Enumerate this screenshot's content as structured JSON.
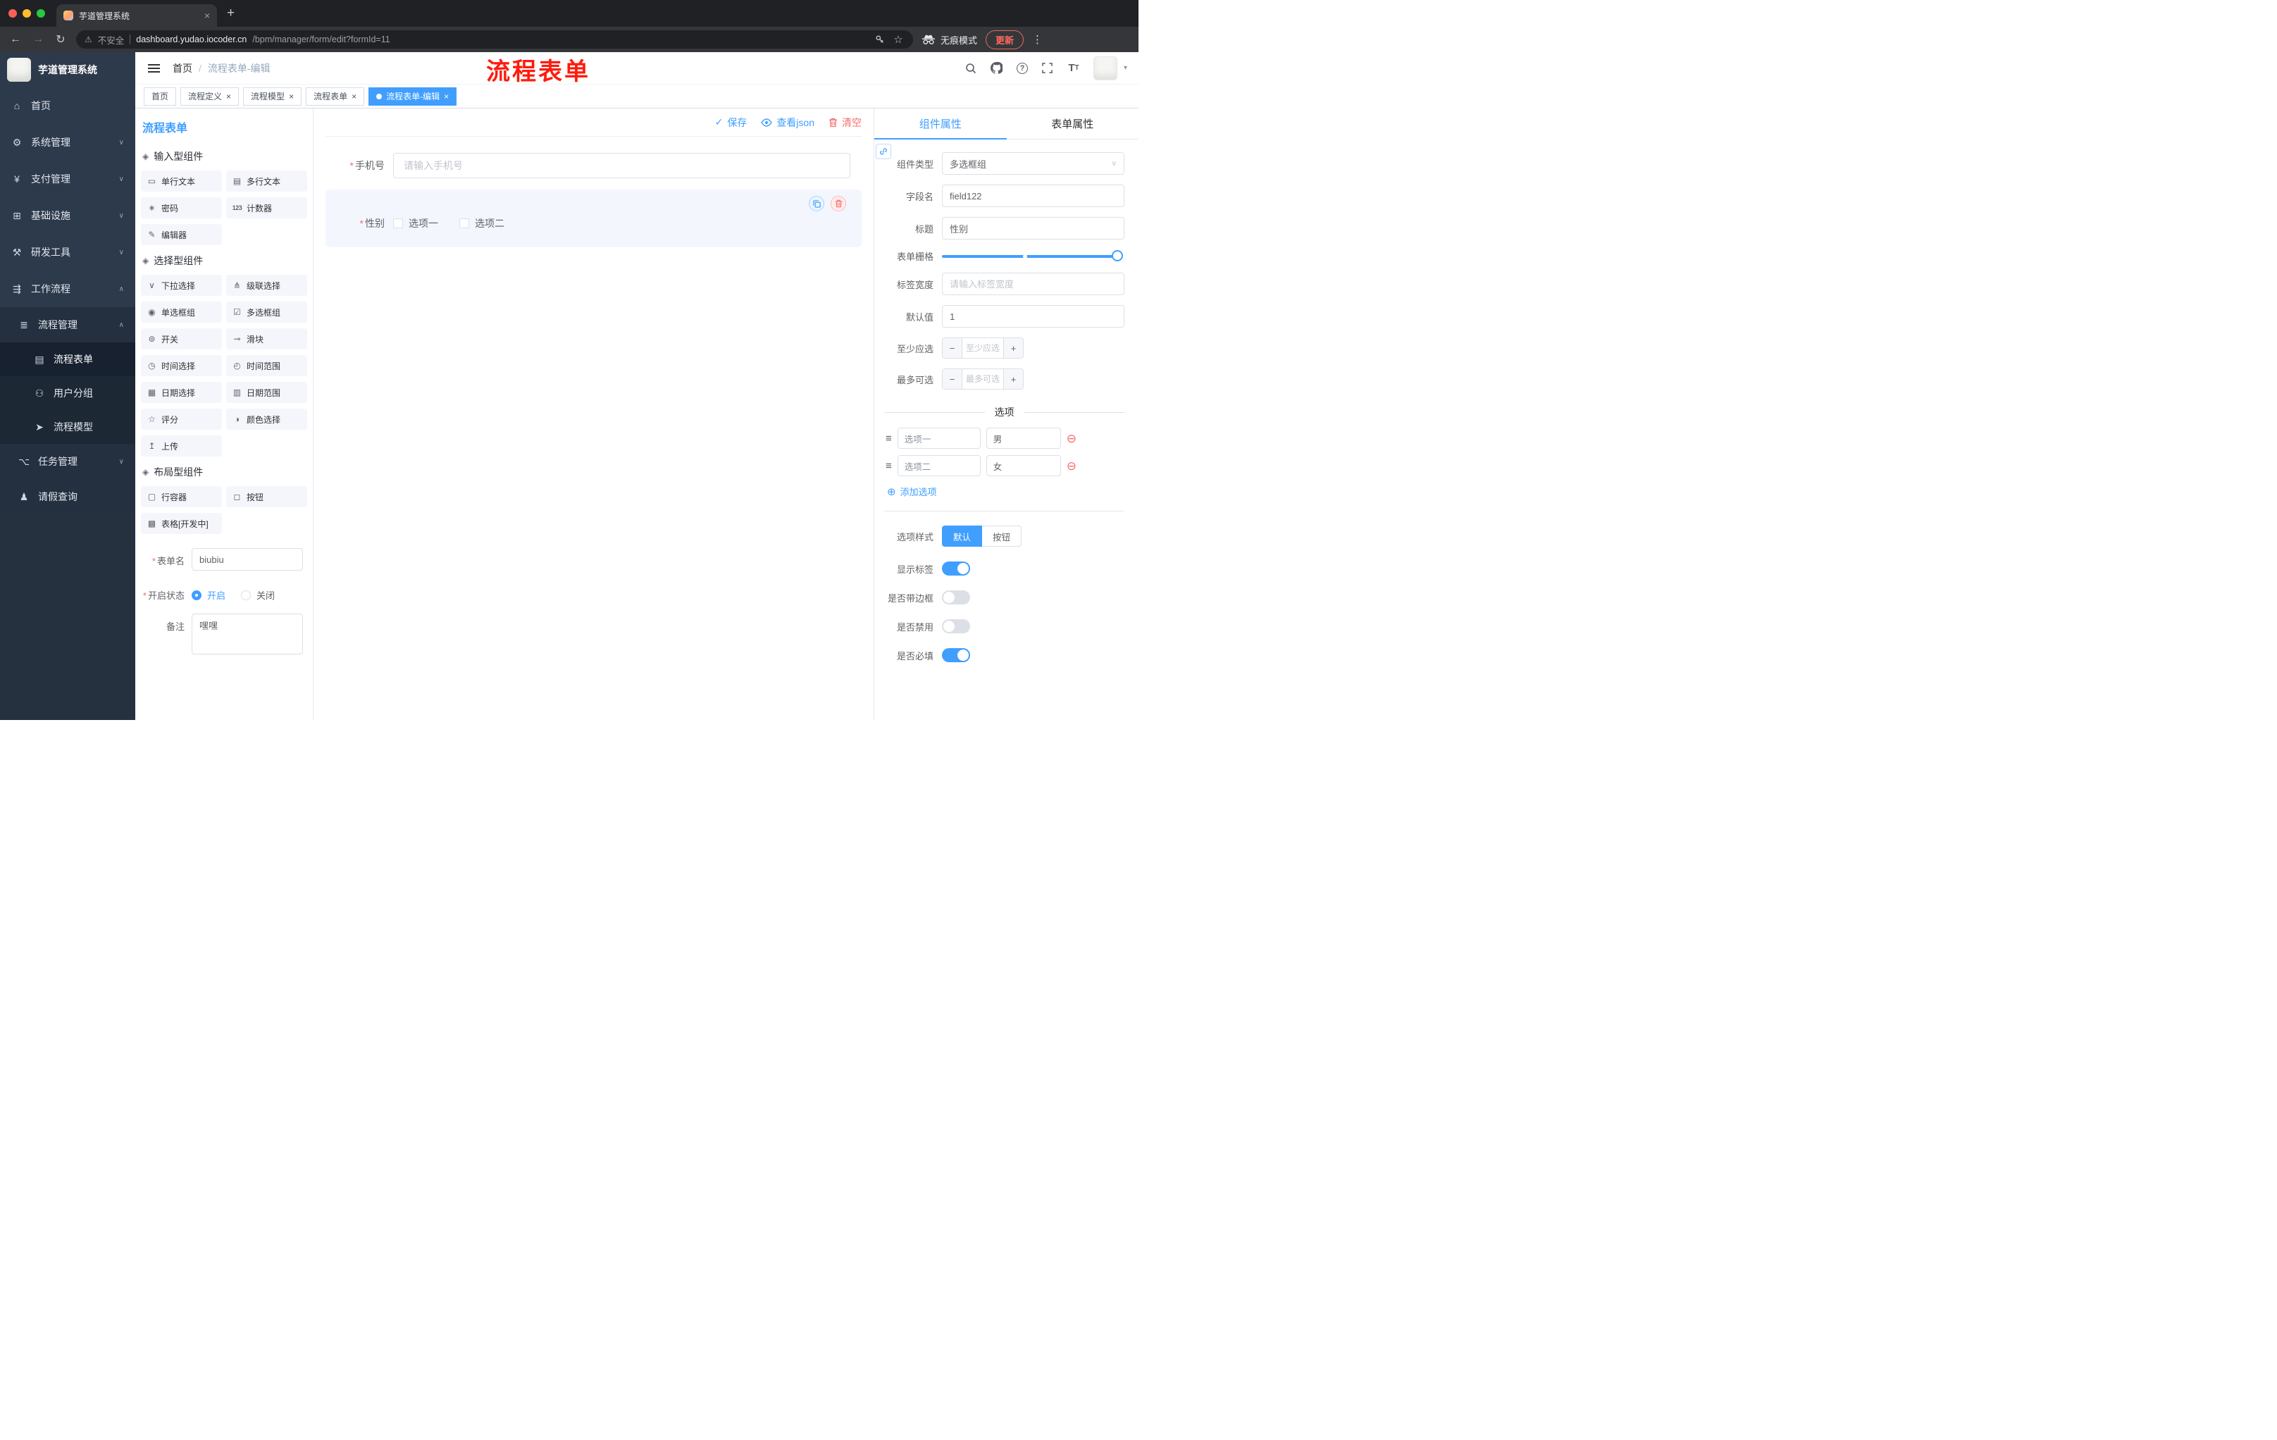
{
  "chrome": {
    "tab": {
      "title": "芋道管理系统",
      "close": "×"
    },
    "newtab": "+",
    "nav": {
      "back": "←",
      "forward": "→",
      "reload": "↻"
    },
    "warning_icon": "⚠",
    "security": "不安全",
    "url_host": "dashboard.yudao.iocoder.cn",
    "url_path": "/bpm/manager/form/edit?formId=11",
    "bookmark_icon": "☆",
    "incognito": "无痕模式",
    "update": "更新",
    "menu_icon": "⋮"
  },
  "sidebar": {
    "title": "芋道管理系统",
    "menu": [
      {
        "icon": "⌂",
        "label": "首页",
        "arrow": ""
      },
      {
        "icon": "⚙",
        "label": "系统管理",
        "arrow": "∨"
      },
      {
        "icon": "¥",
        "label": "支付管理",
        "arrow": "∨"
      },
      {
        "icon": "⊞",
        "label": "基础设施",
        "arrow": "∨"
      },
      {
        "icon": "⚒",
        "label": "研发工具",
        "arrow": "∨"
      },
      {
        "icon": "⇶",
        "label": "工作流程",
        "arrow": "∧"
      }
    ],
    "process_group": {
      "icon": "≣",
      "label": "流程管理",
      "arrow": "∧"
    },
    "process_children": [
      {
        "icon": "▤",
        "label": "流程表单"
      },
      {
        "icon": "⚇",
        "label": "用户分组"
      },
      {
        "icon": "➤",
        "label": "流程模型"
      }
    ],
    "task": {
      "icon": "⌥",
      "label": "任务管理",
      "arrow": "∨"
    },
    "leave": {
      "icon": "♟",
      "label": "请假查询"
    }
  },
  "navbar": {
    "breadcrumb_home": "首页",
    "breadcrumb_sep": "/",
    "breadcrumb_current": "流程表单-编辑",
    "caret": "▾"
  },
  "annotation": "流程表单",
  "close_x": "×",
  "active_dot": "",
  "required_marker": "*",
  "tags": [
    {
      "label": "首页"
    },
    {
      "label": "流程定义"
    },
    {
      "label": "流程模型"
    },
    {
      "label": "流程表单"
    },
    {
      "label": "流程表单-编辑"
    }
  ],
  "palette": {
    "title": "流程表单",
    "group_icon": "◈",
    "groups": [
      {
        "title": "输入型组件",
        "items": [
          {
            "icon": "▭",
            "label": "单行文本"
          },
          {
            "icon": "▤",
            "label": "多行文本"
          },
          {
            "icon": "∗",
            "label": "密码"
          },
          {
            "icon": "123",
            "label": "计数器"
          },
          {
            "icon": "✎",
            "label": "编辑器"
          }
        ]
      },
      {
        "title": "选择型组件",
        "items": [
          {
            "icon": "∨",
            "label": "下拉选择"
          },
          {
            "icon": "⋔",
            "label": "级联选择"
          },
          {
            "icon": "◉",
            "label": "单选框组"
          },
          {
            "icon": "☑",
            "label": "多选框组"
          },
          {
            "icon": "⊚",
            "label": "开关"
          },
          {
            "icon": "⊸",
            "label": "滑块"
          },
          {
            "icon": "◷",
            "label": "时间选择"
          },
          {
            "icon": "◴",
            "label": "时间范围"
          },
          {
            "icon": "▦",
            "label": "日期选择"
          },
          {
            "icon": "▥",
            "label": "日期范围"
          },
          {
            "icon": "☆",
            "label": "评分"
          },
          {
            "icon": "◑",
            "label": "颜色选择"
          },
          {
            "icon": "↥",
            "label": "上传"
          }
        ]
      },
      {
        "title": "布局型组件",
        "items": [
          {
            "icon": "▢",
            "label": "行容器"
          },
          {
            "icon": "◻",
            "label": "按钮"
          },
          {
            "icon": "▩",
            "label": "表格[开发中]"
          }
        ]
      }
    ],
    "form": {
      "name_label": "表单名",
      "name_value": "biubiu",
      "status_label": "开启状态",
      "status_on": "开启",
      "status_off": "关闭",
      "remark_label": "备注",
      "remark_value": "嘿嘿"
    }
  },
  "canvas": {
    "save_icon": "✓",
    "save": "保存",
    "view_json": "查看json",
    "clear": "清空",
    "phone_label": "手机号",
    "phone_placeholder": "请输入手机号",
    "gender_label": "性别",
    "gender_opt1": "选项一",
    "gender_opt2": "选项二"
  },
  "props": {
    "tab_component": "组件属性",
    "tab_form": "表单属性",
    "rows": {
      "type_label": "组件类型",
      "type_value": "多选框组",
      "chevron": "∨",
      "field_label": "字段名",
      "field_value": "field122",
      "title_label": "标题",
      "title_value": "性别",
      "grid_label": "表单栅格",
      "labelw_label": "标签宽度",
      "labelw_placeholder": "请输入标签宽度",
      "default_label": "默认值",
      "default_value": "1",
      "min_label": "至少应选",
      "min_placeholder": "至少应选",
      "max_label": "最多可选",
      "max_placeholder": "最多可选",
      "minus": "−",
      "plus": "+"
    },
    "options": {
      "divider": "选项",
      "drag_icon": "≡",
      "remove_icon": "⊖",
      "add_icon": "⊕",
      "add_label": "添加选项",
      "rows": [
        {
          "label": "选项一",
          "value": "男"
        },
        {
          "label": "选项二",
          "value": "女"
        }
      ]
    },
    "style_label": "选项样式",
    "style_default": "默认",
    "style_button": "按钮",
    "switches": [
      {
        "label": "显示标签"
      },
      {
        "label": "是否带边框"
      },
      {
        "label": "是否禁用"
      },
      {
        "label": "是否必填"
      }
    ]
  },
  "colors": {
    "primary": "#409eff",
    "danger": "#f56c6c"
  }
}
